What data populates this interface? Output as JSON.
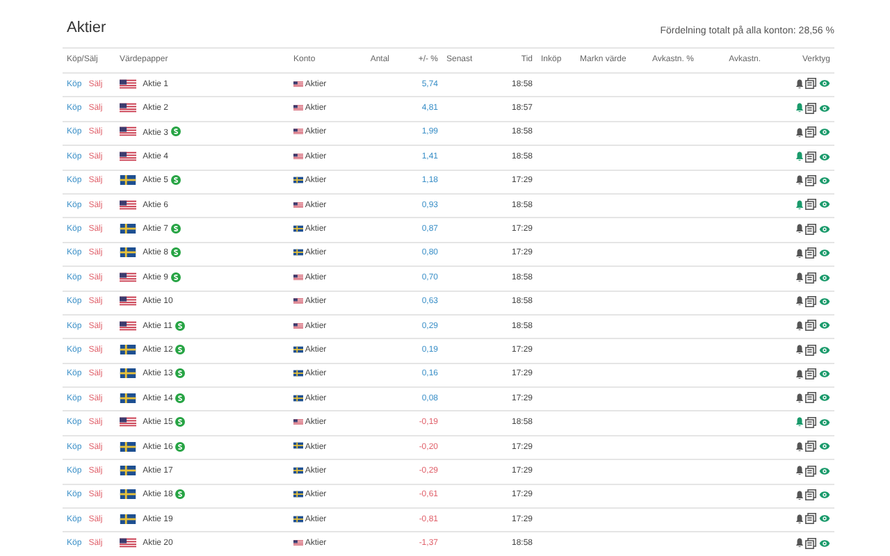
{
  "title": "Aktier",
  "summary": "Fördelning totalt på alla konton: 28,56 %",
  "columns": [
    "Köp/Sälj",
    "Värdepapper",
    "Konto",
    "Antal",
    "+/- %",
    "Senast",
    "Tid",
    "Inköp",
    "Markn värde",
    "Avkastn. %",
    "Avkastn.",
    "Verktyg"
  ],
  "rows": [
    {
      "buy": "Köp",
      "sell": "Sälj",
      "kind": "us",
      "name": "Aktie 1",
      "dividend": false,
      "account": "Aktier",
      "change": "5,74",
      "negative": false,
      "time": "18:58",
      "alert": false
    },
    {
      "buy": "Köp",
      "sell": "Sälj",
      "kind": "us",
      "name": "Aktie 2",
      "dividend": false,
      "account": "Aktier",
      "change": "4,81",
      "negative": false,
      "time": "18:57",
      "alert": true
    },
    {
      "buy": "Köp",
      "sell": "Sälj",
      "kind": "us",
      "name": "Aktie 3",
      "dividend": true,
      "account": "Aktier",
      "change": "1,99",
      "negative": false,
      "time": "18:58",
      "alert": false
    },
    {
      "buy": "Köp",
      "sell": "Sälj",
      "kind": "us",
      "name": "Aktie 4",
      "dividend": false,
      "account": "Aktier",
      "change": "1,41",
      "negative": false,
      "time": "18:58",
      "alert": true
    },
    {
      "buy": "Köp",
      "sell": "Sälj",
      "kind": "se",
      "name": "Aktie 5",
      "dividend": true,
      "account": "Aktier",
      "change": "1,18",
      "negative": false,
      "time": "17:29",
      "alert": false
    },
    {
      "buy": "Köp",
      "sell": "Sälj",
      "kind": "us",
      "name": "Aktie 6",
      "dividend": false,
      "account": "Aktier",
      "change": "0,93",
      "negative": false,
      "time": "18:58",
      "alert": true
    },
    {
      "buy": "Köp",
      "sell": "Sälj",
      "kind": "se",
      "name": "Aktie 7",
      "dividend": true,
      "account": "Aktier",
      "change": "0,87",
      "negative": false,
      "time": "17:29",
      "alert": false
    },
    {
      "buy": "Köp",
      "sell": "Sälj",
      "kind": "se",
      "name": "Aktie 8",
      "dividend": true,
      "account": "Aktier",
      "change": "0,80",
      "negative": false,
      "time": "17:29",
      "alert": false
    },
    {
      "buy": "Köp",
      "sell": "Sälj",
      "kind": "us",
      "name": "Aktie 9",
      "dividend": true,
      "account": "Aktier",
      "change": "0,70",
      "negative": false,
      "time": "18:58",
      "alert": false
    },
    {
      "buy": "Köp",
      "sell": "Sälj",
      "kind": "us",
      "name": "Aktie 10",
      "dividend": false,
      "account": "Aktier",
      "change": "0,63",
      "negative": false,
      "time": "18:58",
      "alert": false
    },
    {
      "buy": "Köp",
      "sell": "Sälj",
      "kind": "us",
      "name": "Aktie 11",
      "dividend": true,
      "account": "Aktier",
      "change": "0,29",
      "negative": false,
      "time": "18:58",
      "alert": false
    },
    {
      "buy": "Köp",
      "sell": "Sälj",
      "kind": "se",
      "name": "Aktie 12",
      "dividend": true,
      "account": "Aktier",
      "change": "0,19",
      "negative": false,
      "time": "17:29",
      "alert": false
    },
    {
      "buy": "Köp",
      "sell": "Sälj",
      "kind": "se",
      "name": "Aktie 13",
      "dividend": true,
      "account": "Aktier",
      "change": "0,16",
      "negative": false,
      "time": "17:29",
      "alert": false
    },
    {
      "buy": "Köp",
      "sell": "Sälj",
      "kind": "se",
      "name": "Aktie 14",
      "dividend": true,
      "account": "Aktier",
      "change": "0,08",
      "negative": false,
      "time": "17:29",
      "alert": false
    },
    {
      "buy": "Köp",
      "sell": "Sälj",
      "kind": "us",
      "name": "Aktie 15",
      "dividend": true,
      "account": "Aktier",
      "change": "-0,19",
      "negative": true,
      "time": "18:58",
      "alert": true
    },
    {
      "buy": "Köp",
      "sell": "Sälj",
      "kind": "se",
      "name": "Aktie 16",
      "dividend": true,
      "account": "Aktier",
      "change": "-0,20",
      "negative": true,
      "time": "17:29",
      "alert": false
    },
    {
      "buy": "Köp",
      "sell": "Sälj",
      "kind": "se",
      "name": "Aktie 17",
      "dividend": false,
      "account": "Aktier",
      "change": "-0,29",
      "negative": true,
      "time": "17:29",
      "alert": false
    },
    {
      "buy": "Köp",
      "sell": "Sälj",
      "kind": "se",
      "name": "Aktie 18",
      "dividend": true,
      "account": "Aktier",
      "change": "-0,61",
      "negative": true,
      "time": "17:29",
      "alert": false
    },
    {
      "buy": "Köp",
      "sell": "Sälj",
      "kind": "se",
      "name": "Aktie 19",
      "dividend": false,
      "account": "Aktier",
      "change": "-0,81",
      "negative": true,
      "time": "17:29",
      "alert": false
    },
    {
      "buy": "Köp",
      "sell": "Sälj",
      "kind": "us",
      "name": "Aktie 20",
      "dividend": false,
      "account": "Aktier",
      "change": "-1,37",
      "negative": true,
      "time": "18:58",
      "alert": false
    }
  ]
}
